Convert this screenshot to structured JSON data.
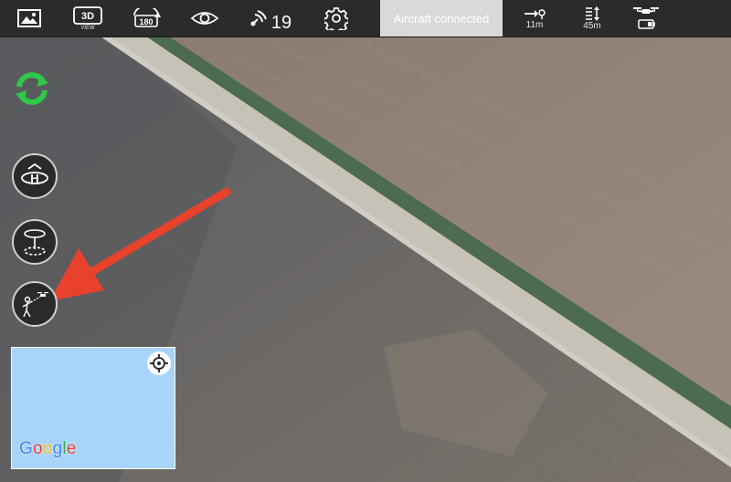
{
  "topbar": {
    "view_3d_label": "3D",
    "view_3d_sub": "VIEW",
    "rotate_label": "180",
    "satellite_count": "19",
    "status": "Aircraft connected",
    "distance": "11m",
    "altitude": "45m"
  },
  "map": {
    "provider_logo": "Google"
  },
  "colors": {
    "topbar_bg": "#2b2b2b",
    "status_bg": "#d9d9d9",
    "refresh_green": "#2fc84a",
    "arrow_red": "#e8422c",
    "map_water": "#a8d4fb"
  },
  "icons": [
    "gallery-icon",
    "view-3d-icon",
    "rotate-180-icon",
    "eye-icon",
    "satellite-icon",
    "gear-icon",
    "home-distance-icon",
    "altitude-icon",
    "drone-battery-icon",
    "refresh-icon",
    "takeoff-icon",
    "orbit-icon",
    "follow-me-icon",
    "locate-icon"
  ]
}
